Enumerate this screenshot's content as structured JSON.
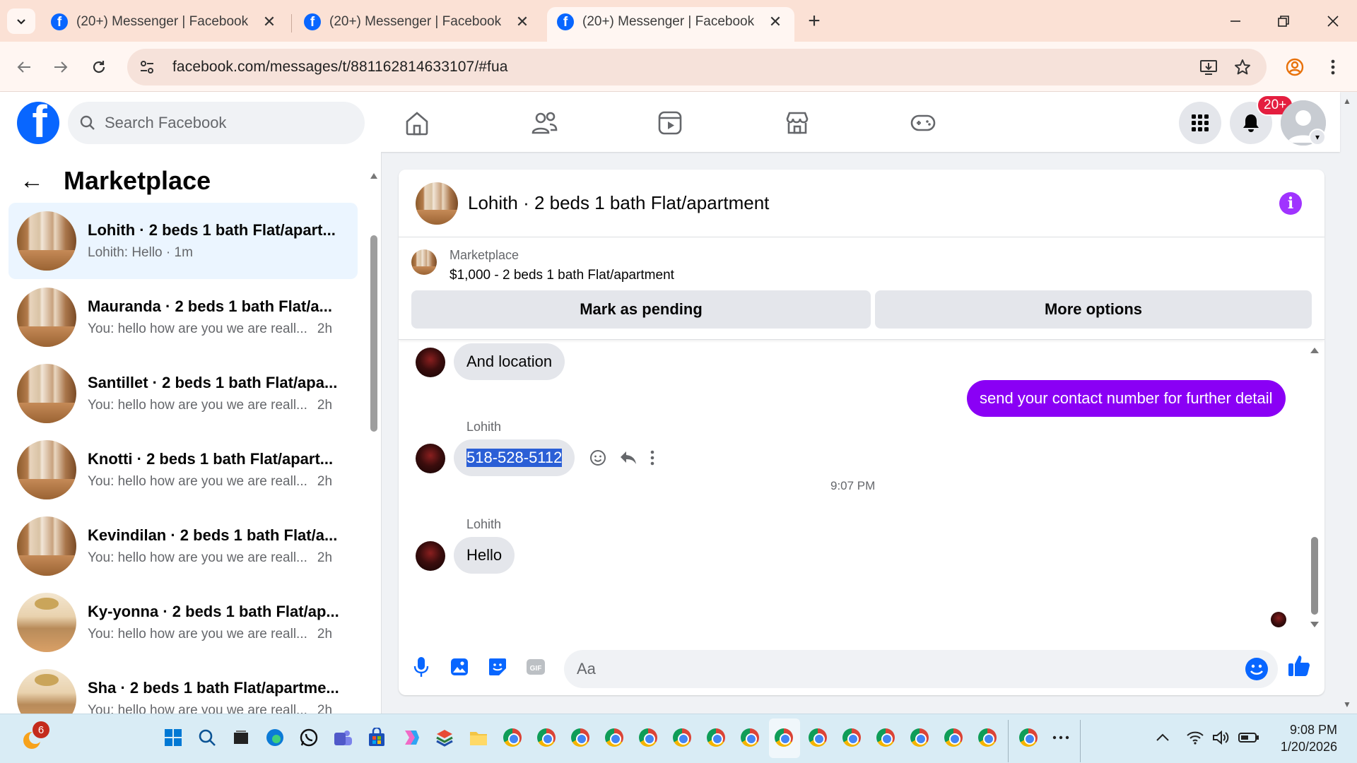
{
  "browser": {
    "tabs": [
      {
        "title": "(20+) Messenger | Facebook",
        "active": false
      },
      {
        "title": "(20+) Messenger | Facebook",
        "active": false
      },
      {
        "title": "(20+) Messenger | Facebook",
        "active": true
      }
    ],
    "url": "facebook.com/messages/t/881162814633107/#fua"
  },
  "fb": {
    "search_placeholder": "Search Facebook",
    "notification_badge": "20+",
    "brand_color": "#0866ff"
  },
  "sidebar": {
    "title": "Marketplace",
    "conversations": [
      {
        "title": "Lohith · 2 beds 1 bath Flat/apart...",
        "preview": "Lohith: Hello · 1m",
        "time": "",
        "selected": true,
        "thumb": "room-a"
      },
      {
        "title": "Mauranda · 2 beds 1 bath Flat/a...",
        "preview": "You: hello how are you we are reall...",
        "time": "2h",
        "selected": false,
        "thumb": "room-a"
      },
      {
        "title": "Santillet · 2 beds 1 bath Flat/apa...",
        "preview": "You: hello how are you we are reall...",
        "time": "2h",
        "selected": false,
        "thumb": "room-a"
      },
      {
        "title": "Knotti · 2 beds 1 bath Flat/apart...",
        "preview": "You: hello how are you we are reall...",
        "time": "2h",
        "selected": false,
        "thumb": "room-a"
      },
      {
        "title": "Kevindilan · 2 beds 1 bath Flat/a...",
        "preview": "You: hello how are you we are reall...",
        "time": "2h",
        "selected": false,
        "thumb": "room-a"
      },
      {
        "title": "Ky-yonna · 2 beds 1 bath Flat/ap...",
        "preview": "You: hello how are you we are reall...",
        "time": "2h",
        "selected": false,
        "thumb": "room-b"
      },
      {
        "title": "Sha · 2 beds 1 bath Flat/apartme...",
        "preview": "You: hello how are you we are reall...",
        "time": "2h",
        "selected": false,
        "thumb": "room-b"
      }
    ]
  },
  "chat": {
    "header_title": "Lohith · 2 beds 1 bath Flat/apartment",
    "listing": {
      "source": "Marketplace",
      "price_title": "$1,000 - 2 beds 1 bath Flat/apartment",
      "pending_button": "Mark as pending",
      "more_button": "More options"
    },
    "messages": {
      "m1": "And location",
      "m2": "send your contact number for further detail",
      "sender_label": "Lohith",
      "m3": "518-528-5112",
      "time_divider": "9:07 PM",
      "m4": "Hello"
    },
    "composer_placeholder": "Aa",
    "accent_color": "#8a00f5"
  },
  "taskbar": {
    "notification_count": "6",
    "time": "9:08 PM",
    "date": "1/20/2026"
  }
}
